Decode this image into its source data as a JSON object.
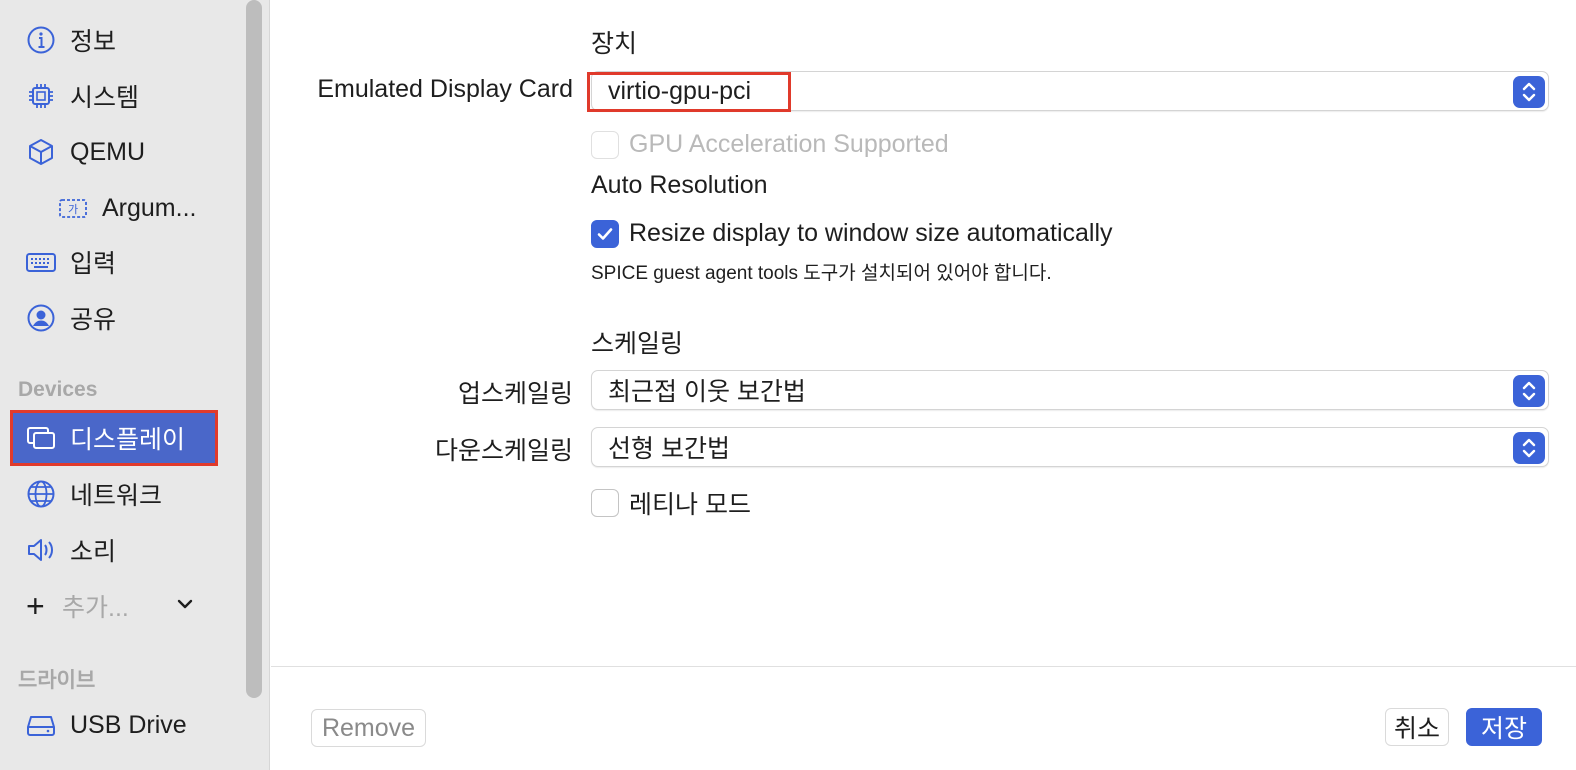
{
  "sidebar": {
    "items": [
      {
        "label": "정보",
        "icon": "info-icon"
      },
      {
        "label": "시스템",
        "icon": "cpu-chip-icon"
      },
      {
        "label": "QEMU",
        "icon": "cube-icon"
      },
      {
        "label": "Argum...",
        "icon": "text-field-icon"
      },
      {
        "label": "입력",
        "icon": "keyboard-icon"
      },
      {
        "label": "공유",
        "icon": "person-circle-icon"
      }
    ],
    "devices_header": "Devices",
    "devices": [
      {
        "label": "디스플레이",
        "icon": "display-icon",
        "selected": true
      },
      {
        "label": "네트워크",
        "icon": "globe-icon"
      },
      {
        "label": "소리",
        "icon": "speaker-icon"
      }
    ],
    "add_label": "추가...",
    "drives_header": "드라이브",
    "drives": [
      {
        "label": "USB Drive",
        "icon": "drive-icon"
      }
    ]
  },
  "main": {
    "device_section": "장치",
    "display_card_label": "Emulated Display Card",
    "display_card_value": "virtio-gpu-pci",
    "gpu_accel_label": "GPU Acceleration Supported",
    "gpu_accel_checked": false,
    "auto_resolution_title": "Auto Resolution",
    "resize_label": "Resize display to window size automatically",
    "resize_checked": true,
    "spice_note": "SPICE guest agent tools 도구가 설치되어 있어야 합니다.",
    "scaling_section": "스케일링",
    "upscaling_label": "업스케일링",
    "upscaling_value": "최근접 이웃 보간법",
    "downscaling_label": "다운스케일링",
    "downscaling_value": "선형 보간법",
    "retina_label": "레티나 모드",
    "retina_checked": false
  },
  "footer": {
    "remove_label": "Remove",
    "cancel_label": "취소",
    "save_label": "저장"
  },
  "colors": {
    "accent": "#3b63d8",
    "selection": "#4a67c9",
    "highlight_outline": "#e03a2b"
  }
}
